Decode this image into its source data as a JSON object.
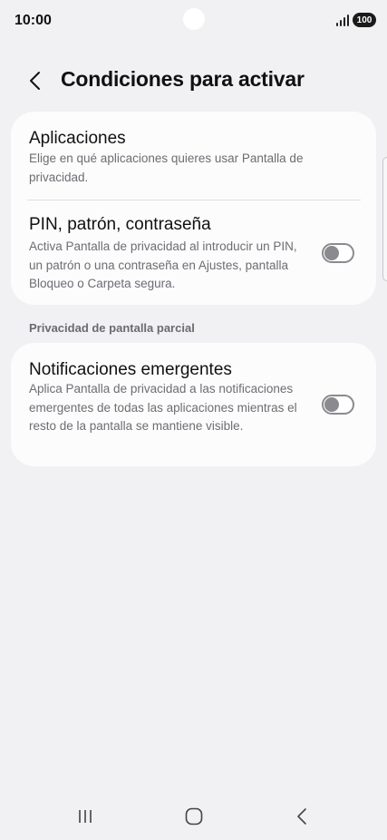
{
  "status_bar": {
    "time": "10:00",
    "battery": "100"
  },
  "header": {
    "back_icon": "chevron-left-icon",
    "title": "Condiciones para activar"
  },
  "cards": {
    "apps": {
      "title": "Aplicaciones",
      "description": "Elige en qué aplicaciones quieres usar Pantalla de privacidad."
    },
    "pin": {
      "title": "PIN, patrón, contraseña",
      "description": "Activa Pantalla de privacidad al introducir un PIN, un patrón o una contraseña en Ajustes, pantalla Bloqueo o Carpeta segura.",
      "toggle_on": false
    }
  },
  "partial_section": {
    "header": "Privacidad de pantalla parcial",
    "notifications": {
      "title": "Notificaciones emergentes",
      "description": "Aplica Pantalla de privacidad a las notificaciones emergentes de todas las aplicaciones mientras el resto de la pantalla se mantiene visible.",
      "toggle_on": false
    }
  },
  "nav_bar": {
    "recent_icon": "recent-apps-icon",
    "home_icon": "home-icon",
    "back_icon": "back-icon"
  },
  "colors": {
    "background": "#f1f1f3",
    "card": "#fcfcfd",
    "secondary_text": "#6d6d72",
    "toggle_off": "#8a8a8f"
  }
}
